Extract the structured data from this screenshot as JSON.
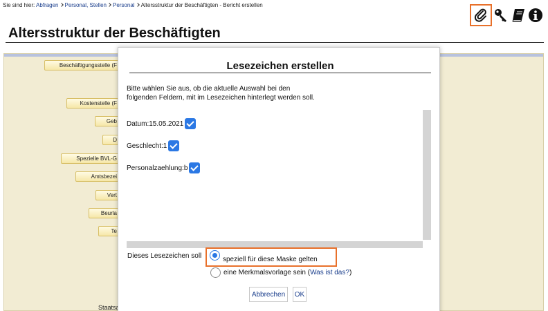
{
  "breadcrumb": {
    "prefix": "Sie sind hier:",
    "items": [
      "Abfragen",
      "Personal, Stellen",
      "Personal",
      "Altersstruktur der Beschäftigten - Bericht erstellen"
    ]
  },
  "toolbar": {
    "icons": [
      "paperclip-icon",
      "key-icon",
      "book-icon",
      "info-icon"
    ],
    "active_icon": "paperclip-icon",
    "highlight_color": "#e8702a"
  },
  "page": {
    "title": "Altersstruktur der Beschäftigten"
  },
  "field_tabs": [
    "Beschäftigungsstelle (F",
    "Kostenstelle (F",
    "Geb",
    "D",
    "Spezielle BVL-G",
    "Amtsbezei",
    "Vert",
    "Beurla",
    "Te"
  ],
  "background_text": {
    "staatsa": "Staatsa"
  },
  "modal": {
    "title": "Lesezeichen erstellen",
    "intro_line1": "Bitte wählen Sie aus, ob die aktuelle Auswahl bei den",
    "intro_line2": "folgenden Feldern, mit im Lesezeichen hinterlegt werden soll.",
    "fields": [
      {
        "label": "Datum:15.05.2021",
        "checked": true
      },
      {
        "label": "Geschlecht:1",
        "checked": true
      },
      {
        "label": "Personalzaehlung:b",
        "checked": true
      }
    ],
    "radio_label": "Dieses Lesezeichen soll",
    "options": [
      {
        "label": "speziell für diese Maske gelten",
        "selected": true
      },
      {
        "label_before": "eine Merkmalsvorlage sein (",
        "link": "Was ist das?",
        "label_after": ")",
        "selected": false
      }
    ],
    "cancel_label": "Abbrechen",
    "ok_label": "OK"
  },
  "colors": {
    "accent": "#2b78e4",
    "link": "#1a3e8c",
    "background_panel": "#f2ecd3"
  }
}
